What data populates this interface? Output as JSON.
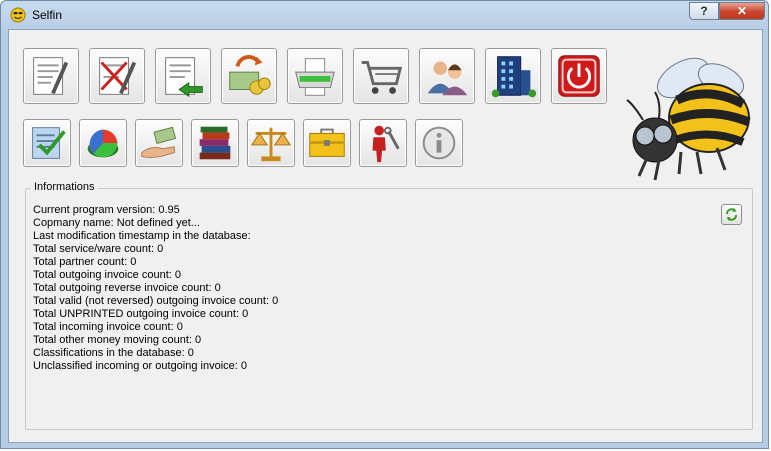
{
  "window": {
    "title": "Selfin"
  },
  "titlebar": {
    "help_label": "?",
    "close_label": "✕"
  },
  "toolbar_row1": [
    {
      "icon": "outgoing-invoice-icon"
    },
    {
      "icon": "reverse-invoice-icon"
    },
    {
      "icon": "incoming-invoice-icon"
    },
    {
      "icon": "money-moving-icon"
    },
    {
      "icon": "printer-icon"
    },
    {
      "icon": "shopping-cart-icon"
    },
    {
      "icon": "partners-icon"
    },
    {
      "icon": "company-building-icon"
    },
    {
      "icon": "power-exit-icon"
    }
  ],
  "toolbar_row2": [
    {
      "icon": "checklist-icon"
    },
    {
      "icon": "pie-chart-icon"
    },
    {
      "icon": "money-hand-icon"
    },
    {
      "icon": "books-icon"
    },
    {
      "icon": "scales-icon"
    },
    {
      "icon": "toolbox-icon"
    },
    {
      "icon": "repair-man-icon"
    },
    {
      "icon": "info-icon"
    }
  ],
  "informations": {
    "legend": "Informations",
    "lines": [
      "Current program version: 0.95",
      "Copmany name: Not defined yet...",
      "Last modification timestamp in the database:",
      "Total service/ware count: 0",
      "Total partner count: 0",
      "Total outgoing invoice count: 0",
      "Total outgoing reverse invoice count: 0",
      "Total valid (not reversed) outgoing invoice count: 0",
      "Total UNPRINTED outgoing invoice count: 0",
      "Total incoming invoice count: 0",
      "Total other money moving count: 0",
      "Classifications in the database: 0",
      "Unclassified incoming or outgoing invoice: 0"
    ]
  },
  "colors": {
    "accent_green": "#3a9a2a",
    "exit_red": "#d01a1a",
    "bee_yellow": "#f2c21a"
  }
}
